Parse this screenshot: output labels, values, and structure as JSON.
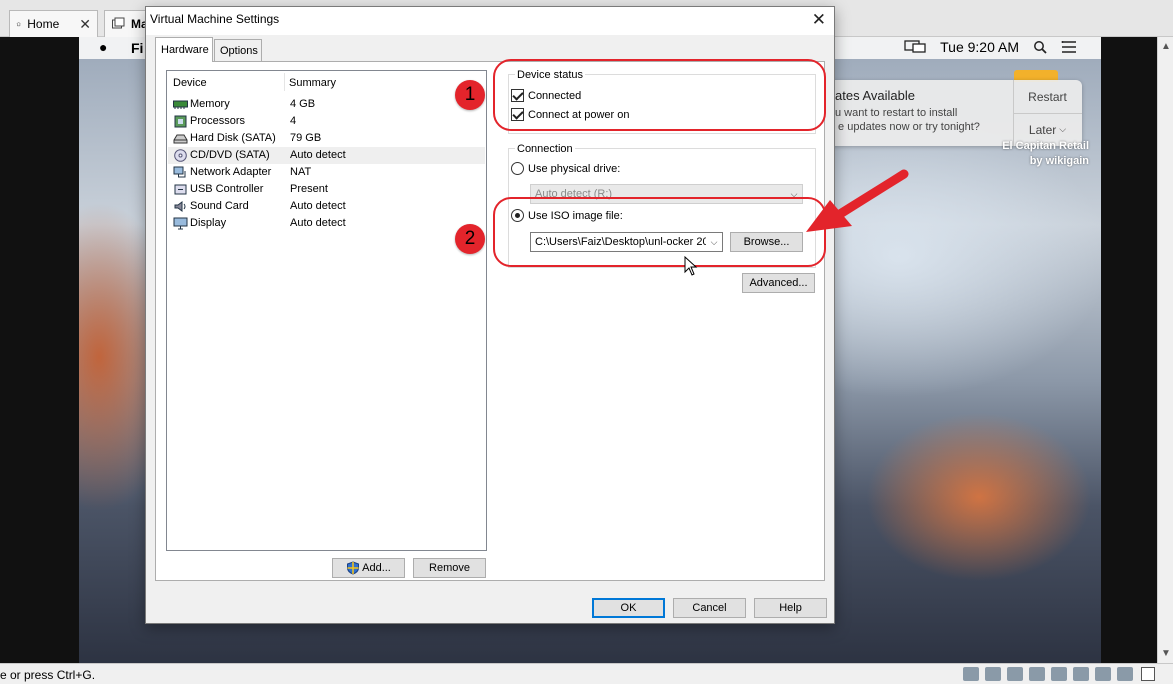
{
  "host": {
    "tabs": [
      {
        "label": "Home",
        "icon": "home-icon"
      },
      {
        "label": "Ma",
        "icon": "vm-icon"
      }
    ],
    "status_text": "e or press Ctrl+G."
  },
  "guest": {
    "menubar": {
      "app": "Fi",
      "time": "Tue 9:20 AM"
    },
    "notification": {
      "title": "ates Available",
      "body": "u want to restart to install\n e updates now or try tonight?",
      "restart": "Restart",
      "later": "Later"
    },
    "watermark": {
      "line1": "El Capitan Retail",
      "line2": "by wikigain"
    }
  },
  "dialog": {
    "title": "Virtual Machine Settings",
    "tabs": [
      "Hardware",
      "Options"
    ],
    "device_list": {
      "headers": {
        "device": "Device",
        "summary": "Summary"
      },
      "rows": [
        {
          "name": "Memory",
          "summary": "4 GB",
          "icon": "memory-icon"
        },
        {
          "name": "Processors",
          "summary": "4",
          "icon": "processor-icon"
        },
        {
          "name": "Hard Disk (SATA)",
          "summary": "79 GB",
          "icon": "hard-disk-icon"
        },
        {
          "name": "CD/DVD (SATA)",
          "summary": "Auto detect",
          "icon": "cd-dvd-icon",
          "selected": true
        },
        {
          "name": "Network Adapter",
          "summary": "NAT",
          "icon": "network-adapter-icon"
        },
        {
          "name": "USB Controller",
          "summary": "Present",
          "icon": "usb-icon"
        },
        {
          "name": "Sound Card",
          "summary": "Auto detect",
          "icon": "sound-card-icon"
        },
        {
          "name": "Display",
          "summary": "Auto detect",
          "icon": "display-icon"
        }
      ]
    },
    "add_button": "Add...",
    "remove_button": "Remove",
    "device_status": {
      "label": "Device status",
      "connected": "Connected",
      "connect_at_power_on": "Connect at power on"
    },
    "connection": {
      "label": "Connection",
      "use_physical_drive": "Use physical drive:",
      "physical_drive_value": "Auto detect (R:)",
      "use_iso": "Use ISO image file:",
      "iso_path": "C:\\Users\\Faiz\\Desktop\\unl-ocker 20",
      "browse": "Browse...",
      "advanced": "Advanced..."
    },
    "ok": "OK",
    "cancel": "Cancel",
    "help": "Help",
    "annotations": [
      "1",
      "2"
    ]
  },
  "colors": {
    "annotation": "#e3242b",
    "focus": "#0078d7"
  }
}
